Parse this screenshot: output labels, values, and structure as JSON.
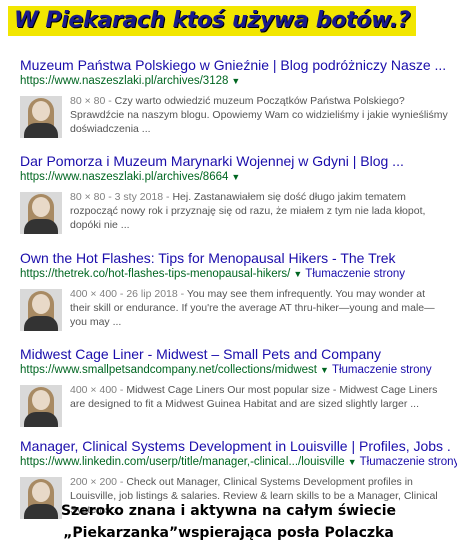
{
  "banner": {
    "title": "W Piekarach ktoś używa botów.?"
  },
  "results": [
    {
      "title": "Muzeum Państwa Polskiego w Gnieźnie | Blog podróżniczy Nasze ...",
      "url": "https://www.naszeszlaki.pl/archives/3128",
      "translate": "",
      "meta": "80 × 80 -",
      "snippet": "Czy warto odwiedzić muzeum Początków Państwa Polskiego? Sprawdźcie na naszym blogu. Opowiemy Wam co widzieliśmy i jakie wynieśliśmy doświadczenia ..."
    },
    {
      "title": "Dar Pomorza i Muzeum Marynarki Wojennej w Gdyni | Blog ...",
      "url": "https://www.naszeszlaki.pl/archives/8664",
      "translate": "",
      "meta": "80 × 80 - 3 sty 2018 -",
      "snippet": "Hej. Zastanawiałem się dość długo jakim tematem rozpocząć nowy rok i przyznaję się od razu, że miałem z tym nie lada kłopot, dopóki nie ..."
    },
    {
      "title": "Own the Hot Flashes: Tips for Menopausal Hikers - The Trek",
      "url": "https://thetrek.co/hot-flashes-tips-menopausal-hikers/",
      "translate": "Tłumaczenie strony",
      "meta": "400 × 400 - 26 lip 2018 -",
      "snippet": "You may see them infrequently. You may wonder at their skill or endurance. If you're the average AT thru-hiker—young and male—you may ..."
    },
    {
      "title": "Midwest Cage Liner - Midwest – Small Pets and Company",
      "url": "https://www.smallpetsandcompany.net/collections/midwest",
      "translate": "Tłumaczenie strony",
      "meta": "400 × 400 -",
      "snippet": "Midwest Cage Liners Our most popular size - Midwest Cage Liners are designed to fit a Midwest Guinea Habitat and are sized slightly larger ..."
    },
    {
      "title": "Manager, Clinical Systems Development in Louisville | Profiles, Jobs ...",
      "url": "https://www.linkedin.com/userp/title/manager,-clinical.../louisville",
      "translate": "Tłumaczenie strony",
      "meta": "200 × 200 -",
      "snippet": "Check out Manager, Clinical Systems Development profiles in Louisville, job listings & salaries. Review & learn skills to be a Manager, Clinical Systems ..."
    }
  ],
  "caption": {
    "line1": "Szeroko znana i aktywna na całym świecie",
    "line2": "„Piekarzanka”wspierająca posła Polaczka"
  }
}
